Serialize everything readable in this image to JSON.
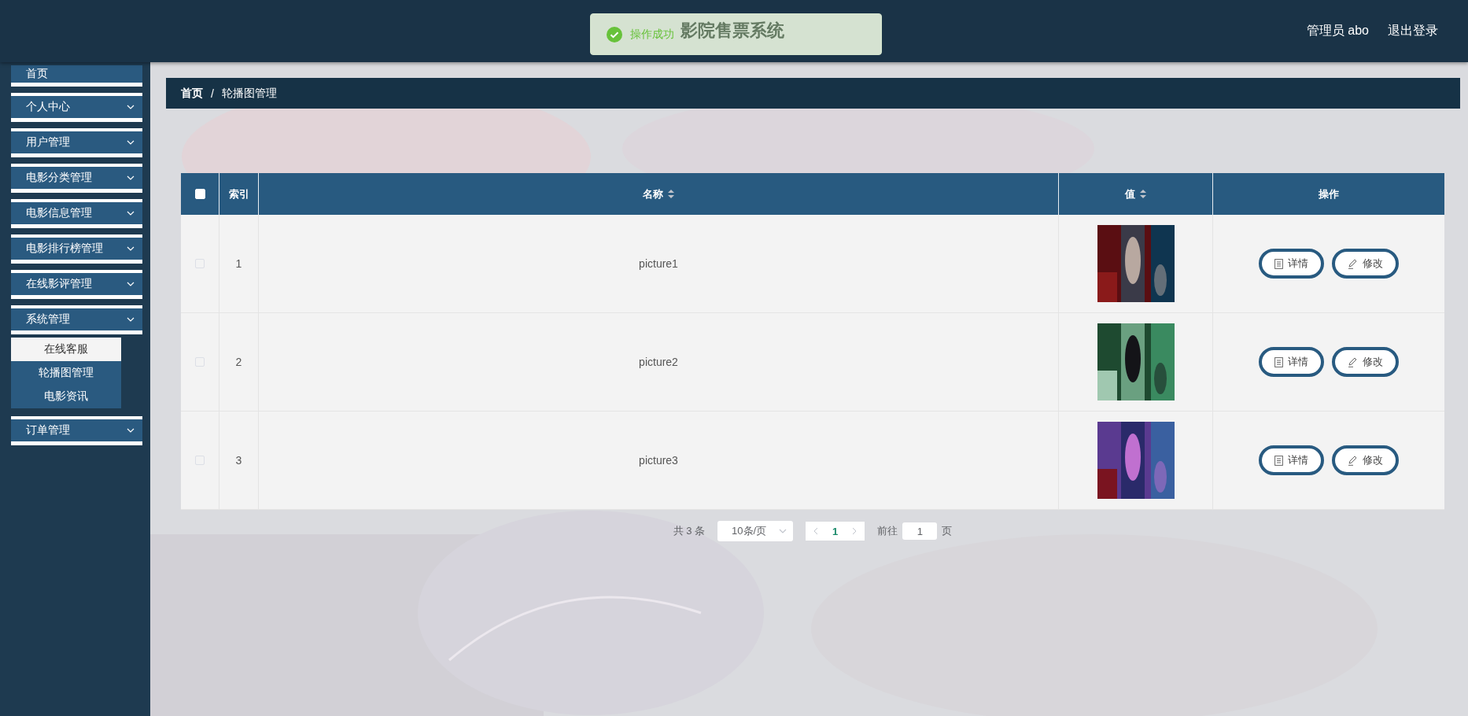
{
  "header": {
    "title": "影院售票系统",
    "user": "管理员 abo",
    "logout": "退出登录"
  },
  "toast": {
    "message": "操作成功"
  },
  "sidebar": {
    "items": [
      {
        "label": "首页",
        "kind": "link"
      },
      {
        "label": "个人中心",
        "kind": "menu"
      },
      {
        "label": "用户管理",
        "kind": "menu"
      },
      {
        "label": "电影分类管理",
        "kind": "menu"
      },
      {
        "label": "电影信息管理",
        "kind": "menu"
      },
      {
        "label": "电影排行榜管理",
        "kind": "menu"
      },
      {
        "label": "在线影评管理",
        "kind": "menu"
      },
      {
        "label": "系统管理",
        "kind": "menu",
        "children": [
          {
            "label": "在线客服",
            "selected": true
          },
          {
            "label": "轮播图管理",
            "selected": false
          },
          {
            "label": "电影资讯",
            "selected": false
          }
        ]
      },
      {
        "label": "订单管理",
        "kind": "menu"
      }
    ]
  },
  "breadcrumb": {
    "separator": "/",
    "items": [
      "首页",
      "轮播图管理"
    ]
  },
  "table": {
    "columns": [
      {
        "kind": "checkbox",
        "checked": false
      },
      {
        "kind": "text",
        "label": "索引",
        "sortable": false
      },
      {
        "kind": "text",
        "label": "名称",
        "sortable": true
      },
      {
        "kind": "text",
        "label": "值",
        "sortable": true
      },
      {
        "kind": "text",
        "label": "操作",
        "sortable": false
      }
    ],
    "rows": [
      {
        "checked": false,
        "index": "1",
        "name": "picture1",
        "actions": [
          "详情",
          "修改"
        ]
      },
      {
        "checked": false,
        "index": "2",
        "name": "picture2",
        "actions": [
          "详情",
          "修改"
        ]
      },
      {
        "checked": false,
        "index": "3",
        "name": "picture3",
        "actions": [
          "详情",
          "修改"
        ]
      }
    ]
  },
  "pagination": {
    "total": "共 3 条",
    "page_size": "10条/页",
    "current": "1",
    "goto_label": "前往",
    "goto_value": "1",
    "goto_suffix": "页"
  }
}
